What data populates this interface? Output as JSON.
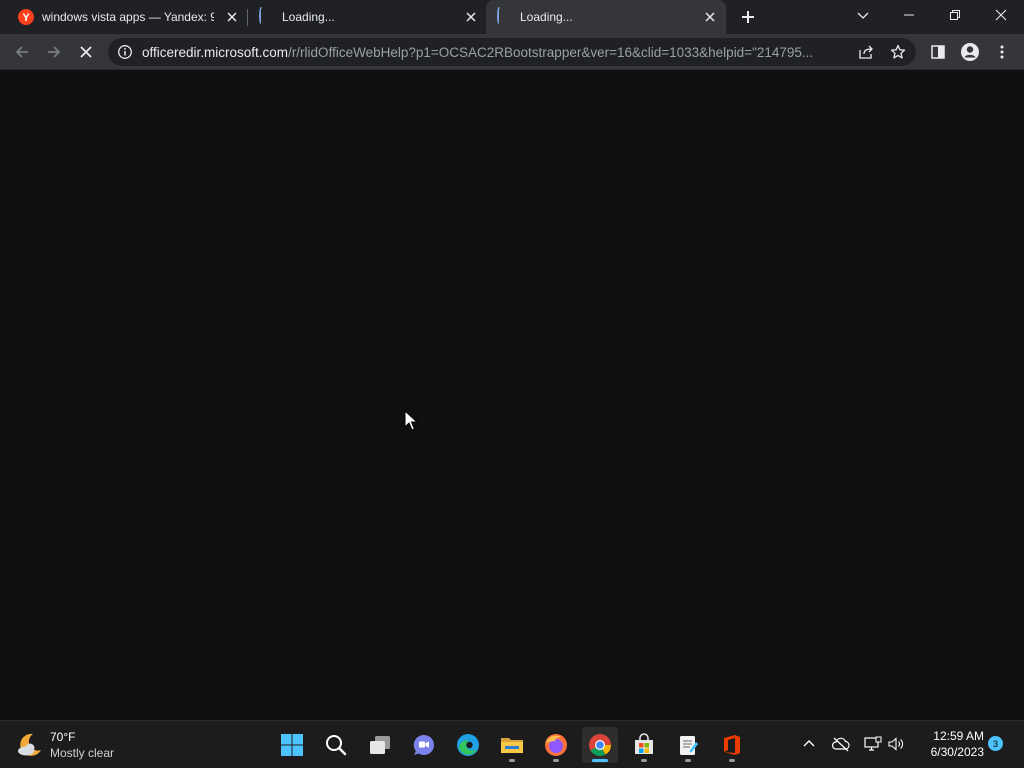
{
  "browser": {
    "tabs": [
      {
        "title": "windows vista apps — Yandex: 9",
        "favicon": "yandex-icon",
        "loading": false
      },
      {
        "title": "Loading...",
        "favicon": "spinner-icon",
        "loading": true
      },
      {
        "title": "Loading...",
        "favicon": "spinner-icon",
        "loading": true,
        "active": true
      }
    ],
    "address": {
      "host": "officeredir.microsoft.com",
      "path": "/r/rlidOfficeWebHelp?p1=OCSAC2RBootstrapper&ver=16&clid=1033&helpid=\"214795..."
    }
  },
  "taskbar": {
    "weather": {
      "temp": "70°F",
      "condition": "Mostly clear"
    },
    "clock": {
      "time": "12:59 AM",
      "date": "6/30/2023"
    },
    "notifications": "3"
  },
  "colors": {
    "tabstrip": "#202124",
    "toolbar": "#35363a",
    "content": "#111010",
    "taskbar": "#1c1c1c",
    "accent": "#4cc2ff"
  }
}
